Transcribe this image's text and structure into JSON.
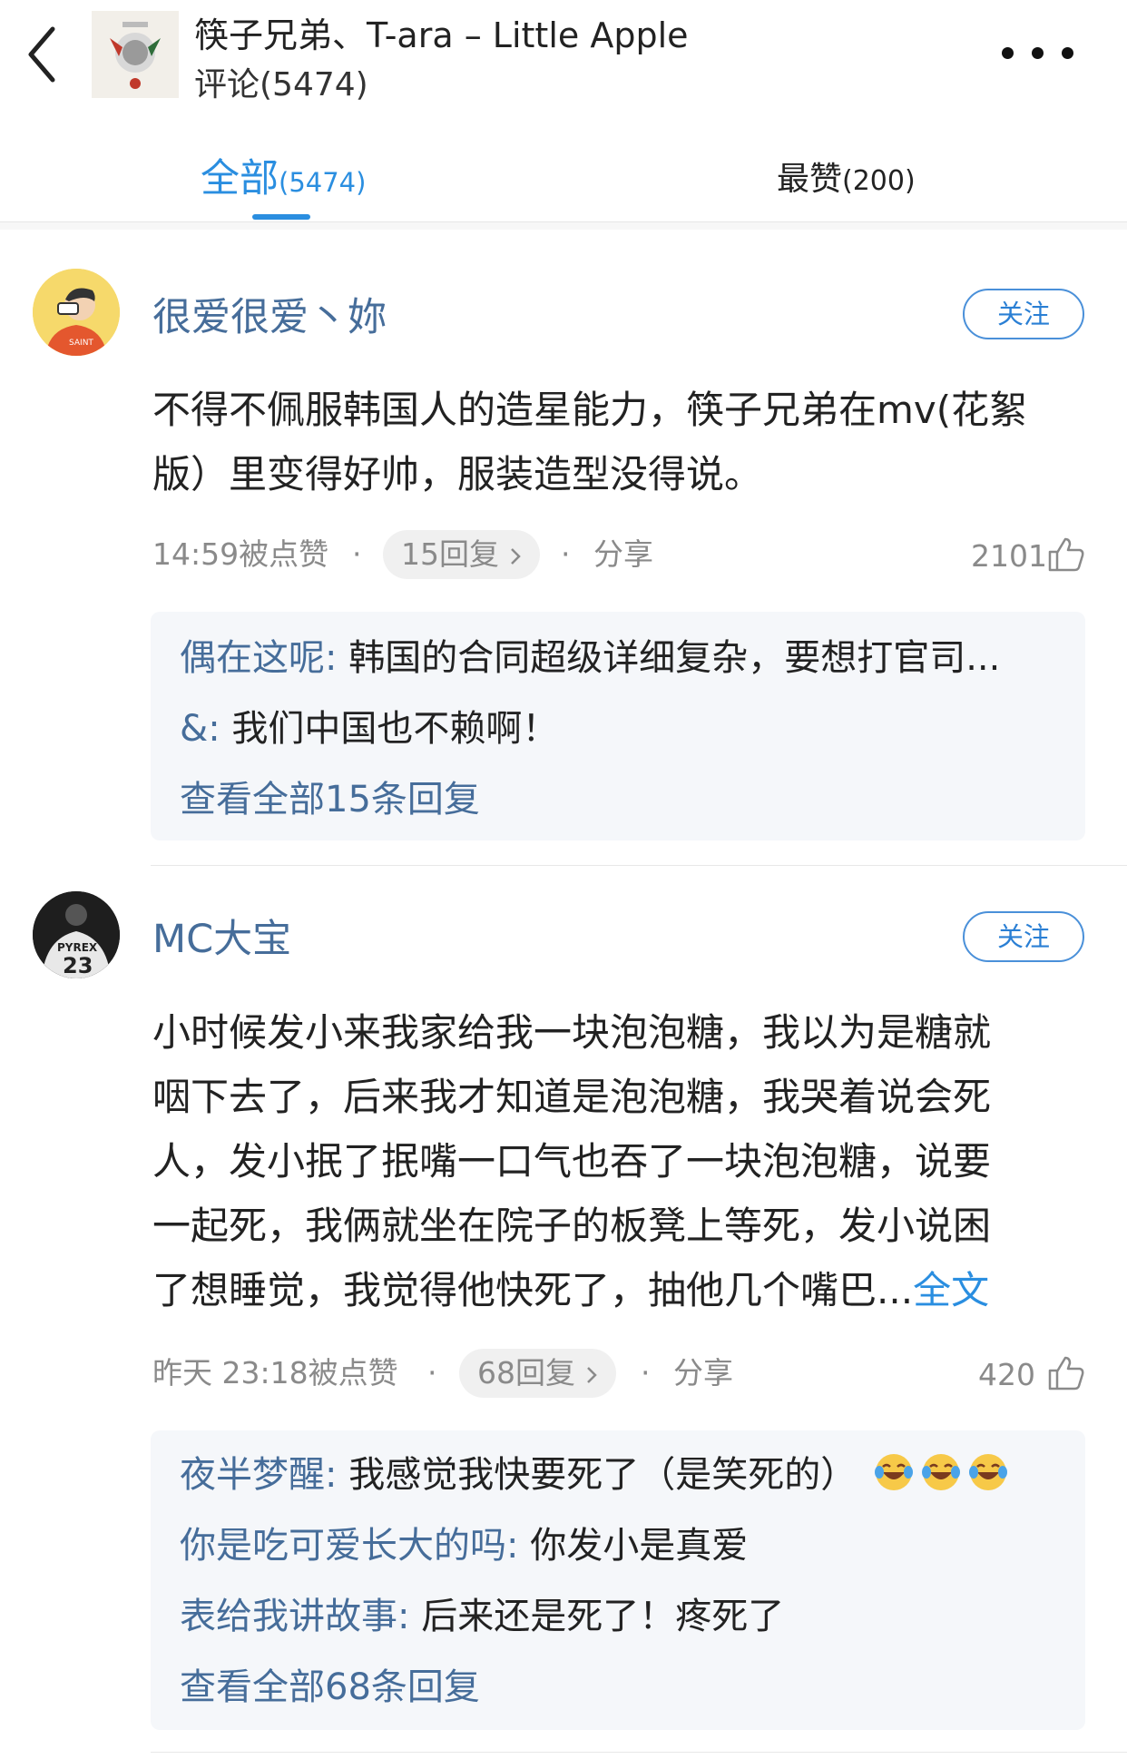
{
  "header": {
    "title": "筷子兄弟、T-ara – Little Apple",
    "subtitle": "评论(5474)"
  },
  "tabs": [
    {
      "label": "全部",
      "count": "(5474)",
      "active": true
    },
    {
      "label": "最赞",
      "count": "(200)",
      "active": false
    }
  ],
  "comments": [
    {
      "username": "很爱很爱丶妳",
      "follow_label": "关注",
      "text_lines": [
        "不得不佩服韩国人的造星能力，筷子兄弟在mv(花絮",
        "版）里变得好帅，服装造型没得说。"
      ],
      "meta_time": "14:59被点赞",
      "dot": "·",
      "reply_count": "15回复",
      "share": "分享",
      "likes": "2101",
      "replies": [
        {
          "name": "偶在这呢:",
          "text": "韩国的合同超级详细复杂，要想打官司..."
        },
        {
          "name": "&:",
          "text": "我们中国也不赖啊！"
        }
      ],
      "view_all": "查看全部15条回复"
    },
    {
      "username": "MC大宝",
      "follow_label": "关注",
      "text_lines": [
        "小时候发小来我家给我一块泡泡糖，我以为是糖就",
        "咽下去了，后来我才知道是泡泡糖，我哭着说会死",
        "人，发小抿了抿嘴一口气也吞了一块泡泡糖，说要",
        "一起死，我俩就坐在院子的板凳上等死，发小说困",
        "了想睡觉，我觉得他快死了，抽他几个嘴巴..."
      ],
      "full_text_link": "全文",
      "meta_time": "昨天 23:18被点赞",
      "dot": "·",
      "reply_count": "68回复",
      "share": "分享",
      "likes": "420",
      "replies": [
        {
          "name": "夜半梦醒:",
          "text": "我感觉我快要死了（是笑死的）"
        },
        {
          "name": "你是吃可爱长大的吗:",
          "text": "你发小是真爱"
        },
        {
          "name": "表给我讲故事:",
          "text": "后来还是死了！疼死了"
        }
      ],
      "view_all": "查看全部68条回复"
    }
  ],
  "colors": {
    "accent": "#2a8ee0",
    "username": "#466d9a",
    "muted": "#8a8a8a",
    "reply_bg": "#f5f7fa"
  },
  "icons": [
    "back-arrow-icon",
    "more-dots-icon",
    "thumb-up-icon",
    "chevron-right-icon",
    "laugh-cry-emoji"
  ]
}
